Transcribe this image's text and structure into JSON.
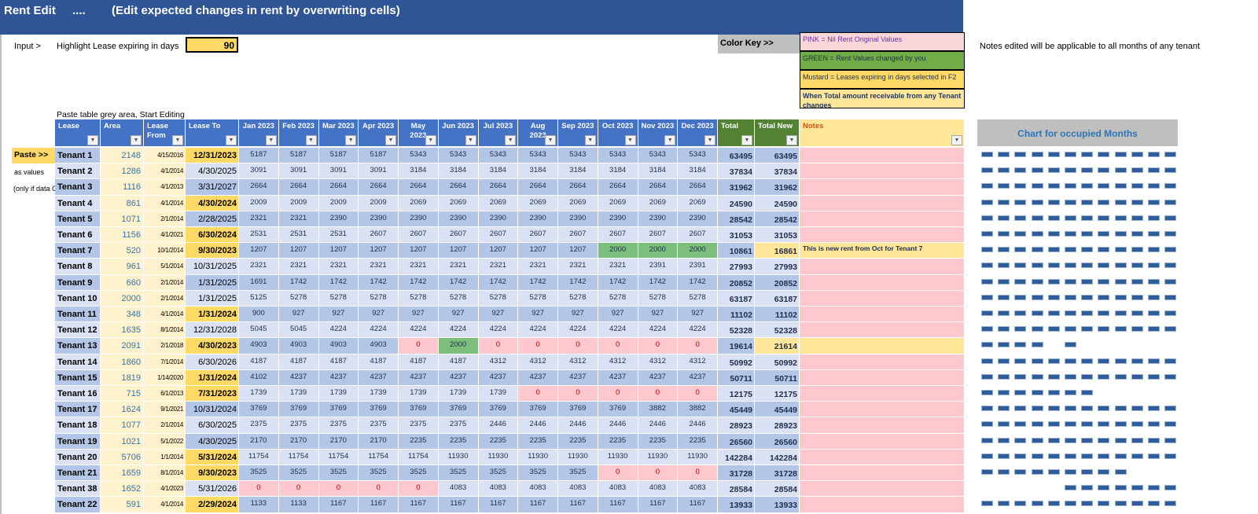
{
  "banner": {
    "title": "Rent Edit",
    "dots": "....",
    "subtitle": "(Edit expected changes in rent by overwriting cells)"
  },
  "input": {
    "label": "Input >",
    "highlight_label": "Highlight Lease expiring in days",
    "days_value": "90"
  },
  "color_key": {
    "label": "Color Key  >>",
    "items": [
      {
        "text": "PINK = Nil Rent Original Values",
        "color": "#F8D7DA"
      },
      {
        "text": "GREEN = Rent Values changed by you",
        "color": "#70AD47"
      },
      {
        "text": "Mustard = Leases expiring in days selected in F2",
        "color": "#FFD966"
      },
      {
        "text": "When Total amount receivable from any Tenant changes",
        "color": "#FFE699"
      }
    ]
  },
  "notes_info": "Notes edited will be applicable to all months of any tenant",
  "paste_hint": "Paste table grey area, Start Editing",
  "side": {
    "paste": "Paste >>",
    "as_values": "as values",
    "only_if": "(only if data C"
  },
  "chart_title": "Chart for occupied Months",
  "colors": {
    "header_blue": "#4472C4",
    "header_green": "#548235",
    "pink": "#FFC7CE",
    "green": "#7CBF7C",
    "mustard": "#FFD966",
    "note_yellow": "#FFE699",
    "dash": "#2F5D9A"
  },
  "headers": [
    "Lease",
    "Area",
    "Lease From",
    "Lease To",
    "Jan 2023",
    "Feb 2023",
    "Mar 2023",
    "Apr 2023",
    "May 2023",
    "Jun 2023",
    "Jul 2023",
    "Aug 2023",
    "Sep 2023",
    "Oct 2023",
    "Nov 2023",
    "Dec 2023",
    "Total",
    "Total New",
    "Notes"
  ],
  "rows": [
    {
      "lease": "Tenant 1",
      "area": "2148",
      "from": "4/15/2016",
      "to": "12/31/2023",
      "expiring": true,
      "m": [
        5187,
        5187,
        5187,
        5187,
        5343,
        5343,
        5343,
        5343,
        5343,
        5343,
        5343,
        5343
      ],
      "changed": [],
      "total": "63495",
      "total_new": "63495",
      "note": ""
    },
    {
      "lease": "Tenant 2",
      "area": "1286",
      "from": "4/1/2014",
      "to": "4/30/2025",
      "expiring": false,
      "m": [
        3091,
        3091,
        3091,
        3091,
        3184,
        3184,
        3184,
        3184,
        3184,
        3184,
        3184,
        3184
      ],
      "changed": [],
      "total": "37834",
      "total_new": "37834",
      "note": ""
    },
    {
      "lease": "Tenant 3",
      "area": "1116",
      "from": "4/1/2013",
      "to": "3/31/2027",
      "expiring": false,
      "m": [
        2664,
        2664,
        2664,
        2664,
        2664,
        2664,
        2664,
        2664,
        2664,
        2664,
        2664,
        2664
      ],
      "changed": [],
      "total": "31962",
      "total_new": "31962",
      "note": ""
    },
    {
      "lease": "Tenant 4",
      "area": "861",
      "from": "4/1/2014",
      "to": "4/30/2024",
      "expiring": true,
      "m": [
        2009,
        2009,
        2009,
        2009,
        2069,
        2069,
        2069,
        2069,
        2069,
        2069,
        2069,
        2069
      ],
      "changed": [],
      "total": "24590",
      "total_new": "24590",
      "note": ""
    },
    {
      "lease": "Tenant 5",
      "area": "1071",
      "from": "2/1/2014",
      "to": "2/28/2025",
      "expiring": false,
      "m": [
        2321,
        2321,
        2390,
        2390,
        2390,
        2390,
        2390,
        2390,
        2390,
        2390,
        2390,
        2390
      ],
      "changed": [],
      "total": "28542",
      "total_new": "28542",
      "note": ""
    },
    {
      "lease": "Tenant 6",
      "area": "1156",
      "from": "4/1/2021",
      "to": "6/30/2024",
      "expiring": true,
      "m": [
        2531,
        2531,
        2531,
        2607,
        2607,
        2607,
        2607,
        2607,
        2607,
        2607,
        2607,
        2607
      ],
      "changed": [],
      "total": "31053",
      "total_new": "31053",
      "note": ""
    },
    {
      "lease": "Tenant 7",
      "area": "520",
      "from": "10/1/2014",
      "to": "9/30/2023",
      "expiring": true,
      "m": [
        1207,
        1207,
        1207,
        1207,
        1207,
        1207,
        1207,
        1207,
        1207,
        2000,
        2000,
        2000
      ],
      "changed": [
        9,
        10,
        11
      ],
      "total": "10861",
      "total_new": "16861",
      "note": "This is new rent from Oct for Tenant 7"
    },
    {
      "lease": "Tenant 8",
      "area": "961",
      "from": "5/1/2014",
      "to": "10/31/2025",
      "expiring": false,
      "m": [
        2321,
        2321,
        2321,
        2321,
        2321,
        2321,
        2321,
        2321,
        2321,
        2321,
        2391,
        2391
      ],
      "changed": [],
      "total": "27993",
      "total_new": "27993",
      "note": ""
    },
    {
      "lease": "Tenant 9",
      "area": "660",
      "from": "2/1/2014",
      "to": "1/31/2025",
      "expiring": false,
      "m": [
        1691,
        1742,
        1742,
        1742,
        1742,
        1742,
        1742,
        1742,
        1742,
        1742,
        1742,
        1742
      ],
      "changed": [],
      "total": "20852",
      "total_new": "20852",
      "note": ""
    },
    {
      "lease": "Tenant 10",
      "area": "2000",
      "from": "2/1/2014",
      "to": "1/31/2025",
      "expiring": false,
      "m": [
        5125,
        5278,
        5278,
        5278,
        5278,
        5278,
        5278,
        5278,
        5278,
        5278,
        5278,
        5278
      ],
      "changed": [],
      "total": "63187",
      "total_new": "63187",
      "note": ""
    },
    {
      "lease": "Tenant 11",
      "area": "348",
      "from": "4/1/2014",
      "to": "1/31/2024",
      "expiring": true,
      "m": [
        900,
        927,
        927,
        927,
        927,
        927,
        927,
        927,
        927,
        927,
        927,
        927
      ],
      "changed": [],
      "total": "11102",
      "total_new": "11102",
      "note": ""
    },
    {
      "lease": "Tenant 12",
      "area": "1635",
      "from": "8/1/2014",
      "to": "12/31/2028",
      "expiring": false,
      "m": [
        5045,
        5045,
        4224,
        4224,
        4224,
        4224,
        4224,
        4224,
        4224,
        4224,
        4224,
        4224
      ],
      "changed": [],
      "total": "52328",
      "total_new": "52328",
      "note": ""
    },
    {
      "lease": "Tenant 13",
      "area": "2091",
      "from": "2/1/2018",
      "to": "4/30/2023",
      "expiring": true,
      "m": [
        4903,
        4903,
        4903,
        4903,
        0,
        2000,
        0,
        0,
        0,
        0,
        0,
        0
      ],
      "changed": [
        5
      ],
      "total": "19614",
      "total_new": "21614",
      "note": ""
    },
    {
      "lease": "Tenant 14",
      "area": "1860",
      "from": "7/1/2014",
      "to": "6/30/2026",
      "expiring": false,
      "m": [
        4187,
        4187,
        4187,
        4187,
        4187,
        4187,
        4312,
        4312,
        4312,
        4312,
        4312,
        4312
      ],
      "changed": [],
      "total": "50992",
      "total_new": "50992",
      "note": ""
    },
    {
      "lease": "Tenant 15",
      "area": "1819",
      "from": "1/14/2020",
      "to": "1/31/2024",
      "expiring": true,
      "m": [
        4102,
        4237,
        4237,
        4237,
        4237,
        4237,
        4237,
        4237,
        4237,
        4237,
        4237,
        4237
      ],
      "changed": [],
      "total": "50711",
      "total_new": "50711",
      "note": ""
    },
    {
      "lease": "Tenant 16",
      "area": "715",
      "from": "6/1/2013",
      "to": "7/31/2023",
      "expiring": true,
      "m": [
        1739,
        1739,
        1739,
        1739,
        1739,
        1739,
        1739,
        0,
        0,
        0,
        0,
        0
      ],
      "changed": [],
      "total": "12175",
      "total_new": "12175",
      "note": ""
    },
    {
      "lease": "Tenant 17",
      "area": "1624",
      "from": "9/1/2021",
      "to": "10/31/2024",
      "expiring": false,
      "m": [
        3769,
        3769,
        3769,
        3769,
        3769,
        3769,
        3769,
        3769,
        3769,
        3769,
        3882,
        3882
      ],
      "changed": [],
      "total": "45449",
      "total_new": "45449",
      "note": ""
    },
    {
      "lease": "Tenant 18",
      "area": "1077",
      "from": "2/1/2014",
      "to": "6/30/2025",
      "expiring": false,
      "m": [
        2375,
        2375,
        2375,
        2375,
        2375,
        2375,
        2446,
        2446,
        2446,
        2446,
        2446,
        2446
      ],
      "changed": [],
      "total": "28923",
      "total_new": "28923",
      "note": ""
    },
    {
      "lease": "Tenant 19",
      "area": "1021",
      "from": "5/1/2022",
      "to": "4/30/2025",
      "expiring": false,
      "m": [
        2170,
        2170,
        2170,
        2170,
        2235,
        2235,
        2235,
        2235,
        2235,
        2235,
        2235,
        2235
      ],
      "changed": [],
      "total": "26560",
      "total_new": "26560",
      "note": ""
    },
    {
      "lease": "Tenant 20",
      "area": "5706",
      "from": "1/1/2014",
      "to": "5/31/2024",
      "expiring": true,
      "m": [
        11754,
        11754,
        11754,
        11754,
        11754,
        11930,
        11930,
        11930,
        11930,
        11930,
        11930,
        11930
      ],
      "changed": [],
      "total": "142284",
      "total_new": "142284",
      "note": ""
    },
    {
      "lease": "Tenant 21",
      "area": "1659",
      "from": "8/1/2014",
      "to": "9/30/2023",
      "expiring": true,
      "m": [
        3525,
        3525,
        3525,
        3525,
        3525,
        3525,
        3525,
        3525,
        3525,
        0,
        0,
        0
      ],
      "changed": [],
      "total": "31728",
      "total_new": "31728",
      "note": ""
    },
    {
      "lease": "Tenant 38",
      "area": "1652",
      "from": "4/1/2023",
      "to": "5/31/2026",
      "expiring": false,
      "m": [
        0,
        0,
        0,
        0,
        0,
        4083,
        4083,
        4083,
        4083,
        4083,
        4083,
        4083
      ],
      "changed": [],
      "total": "28584",
      "total_new": "28584",
      "note": ""
    },
    {
      "lease": "Tenant 22",
      "area": "591",
      "from": "4/1/2014",
      "to": "2/29/2024",
      "expiring": true,
      "m": [
        1133,
        1133,
        1167,
        1167,
        1167,
        1167,
        1167,
        1167,
        1167,
        1167,
        1167,
        1167
      ],
      "changed": [],
      "total": "13933",
      "total_new": "13933",
      "note": ""
    }
  ]
}
